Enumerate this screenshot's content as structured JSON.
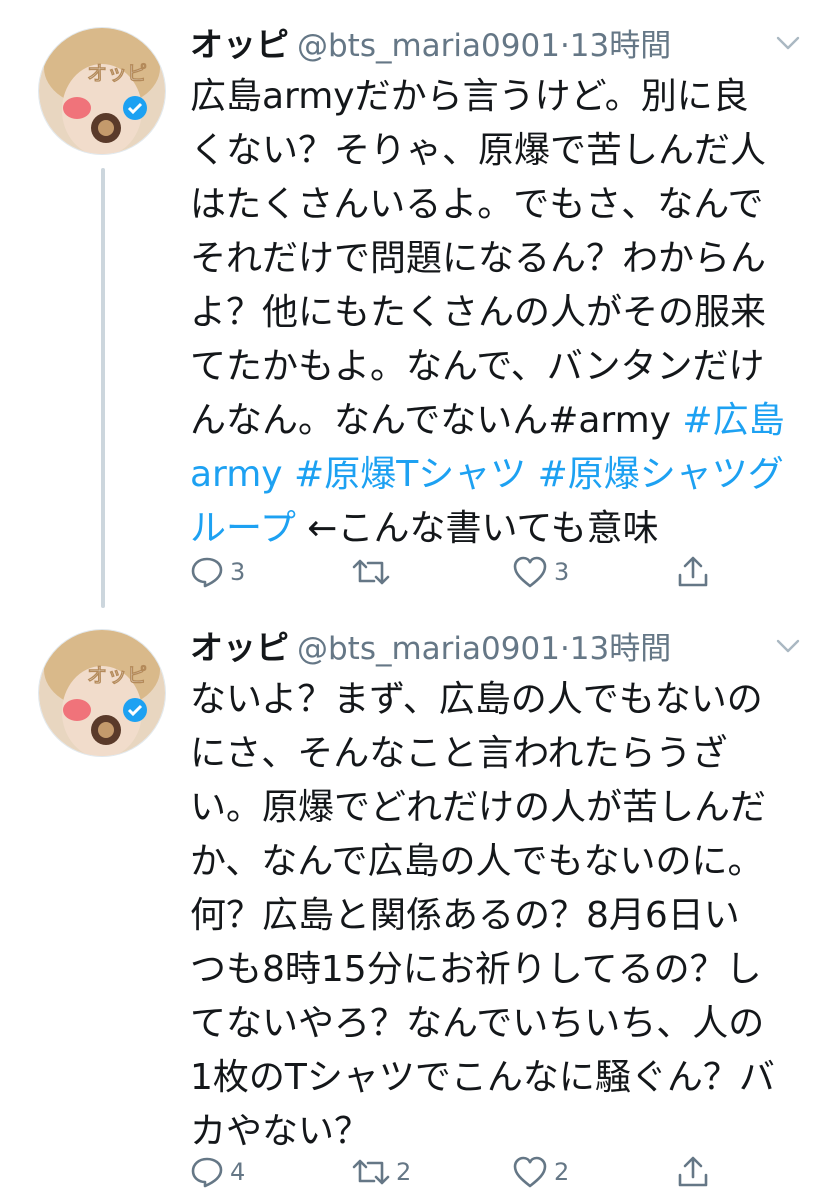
{
  "colors": {
    "text": "#14171a",
    "muted": "#657786",
    "hashtag": "#1da1f2",
    "thread_line": "#ccd6dd"
  },
  "tweets": [
    {
      "display_name": "オッピ",
      "handle": "@bts_maria0901",
      "separator": "·",
      "time": "13時間",
      "body_lines": [
        [
          {
            "t": "広島armyだから言うけど。別に良"
          }
        ],
        [
          {
            "t": "くない？そりゃ、原爆で苦しんだ人"
          }
        ],
        [
          {
            "t": "はたくさんいるよ。でもさ、なんで"
          }
        ],
        [
          {
            "t": "それだけで問題になるん？わからん"
          }
        ],
        [
          {
            "t": "よ？他にもたくさんの人がその服来"
          }
        ],
        [
          {
            "t": "てたかもよ。なんで、バンタンだけ"
          }
        ],
        [
          {
            "t": "んなん。なんでないん#army "
          },
          {
            "t": "#広島",
            "tag": true
          }
        ],
        [
          {
            "t": "army #原爆Tシャツ #原爆シャツグ",
            "tag": true
          }
        ],
        [
          {
            "t": "ループ",
            "tag": true
          },
          {
            "t": " ←こんな書いても意味"
          }
        ]
      ],
      "reply_count": "3",
      "retweet_count": "",
      "like_count": "3",
      "icons": [
        "reply-icon",
        "retweet-icon",
        "like-icon",
        "share-icon"
      ]
    },
    {
      "display_name": "オッピ",
      "handle": "@bts_maria0901",
      "separator": "·",
      "time": "13時間",
      "body_lines": [
        [
          {
            "t": "ないよ？まず、広島の人でもないの"
          }
        ],
        [
          {
            "t": "にさ、そんなこと言われたらうざ"
          }
        ],
        [
          {
            "t": "い。原爆でどれだけの人が苦しんだ"
          }
        ],
        [
          {
            "t": "か、なんで広島の人でもないのに。"
          }
        ],
        [
          {
            "t": "何？広島と関係あるの？8月6日い"
          }
        ],
        [
          {
            "t": "つも8時15分にお祈りしてるの？し"
          }
        ],
        [
          {
            "t": "てないやろ？なんでいちいち、人の"
          }
        ],
        [
          {
            "t": "1枚のTシャツでこんなに騒ぐん？バ"
          }
        ],
        [
          {
            "t": "カやない？"
          }
        ]
      ],
      "reply_count": "4",
      "retweet_count": "2",
      "like_count": "2",
      "icons": [
        "reply-icon",
        "retweet-icon",
        "like-icon",
        "share-icon"
      ]
    }
  ]
}
